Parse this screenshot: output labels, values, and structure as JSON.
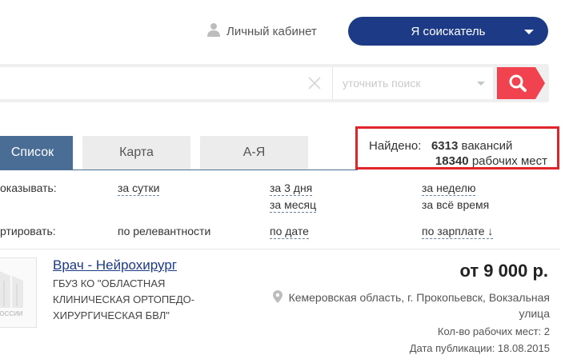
{
  "header": {
    "cabinet_label": "Личный кабинет",
    "role_button_label": "Я соискатель"
  },
  "search": {
    "query_value": "",
    "refine_placeholder": "уточнить поиск"
  },
  "tabs": [
    {
      "label": "Список",
      "active": true
    },
    {
      "label": "Карта",
      "active": false
    },
    {
      "label": "А-Я",
      "active": false
    }
  ],
  "found": {
    "prefix": "Найдено:",
    "vacancies_count": "6313",
    "vacancies_label": "вакансий",
    "places_count": "18340",
    "places_label": "рабочих мест"
  },
  "filters": {
    "show_label": "оказывать:",
    "show_options": [
      "за сутки",
      "за 3 дня",
      "за неделю",
      "за месяц",
      "за всё время"
    ],
    "sort_label": "ртировать:",
    "sort_options": [
      "по релевантности",
      "по дате",
      "по зарплате ↓"
    ]
  },
  "vacancy": {
    "logo_text": "РОССИИ",
    "title": "Врач - Нейрохирург",
    "employer": "ГБУЗ КО \"ОБЛАСТНАЯ КЛИНИЧЕСКАЯ ОРТОПЕДО-ХИРУРГИЧЕСКАЯ БВЛ\"",
    "salary": "от 9 000 р.",
    "location": "Кемеровская область, г. Прокопьевск, Вокзальная улица",
    "places": "Кол-во рабочих мест: 2",
    "published": "Дата публикации: 18.08.2015"
  },
  "colors": {
    "brand_blue": "#1d3a86",
    "tab_active": "#4a6d96",
    "search_button": "#f0434f",
    "highlight_border": "#e0242a"
  }
}
